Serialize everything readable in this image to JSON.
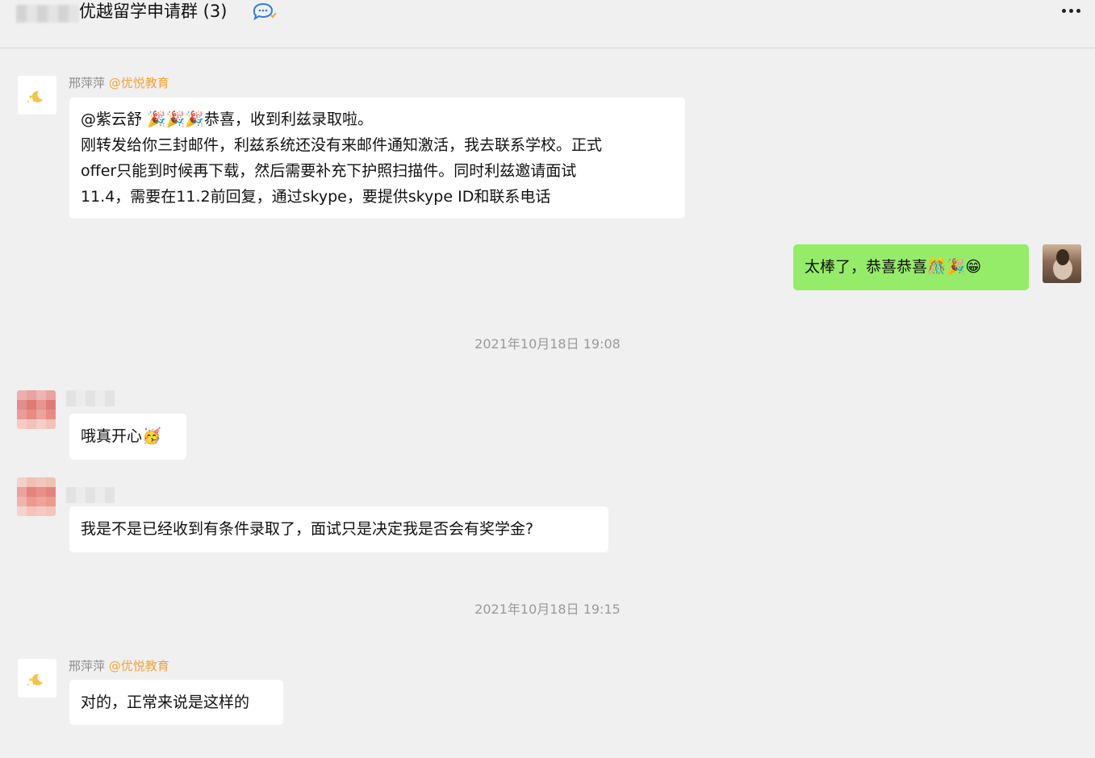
{
  "header": {
    "title": "优越留学申请群 (3)",
    "icons": [
      "chat-bubble-icon",
      "more-dots-icon"
    ]
  },
  "messages": [
    {
      "sender_name": "邢萍萍",
      "sender_org": "@优悦教育",
      "avatar": "moon-stars-icon",
      "lines": [
        "@紫云舒 🎉🎉🎉恭喜，收到利兹录取啦。",
        "刚转发给你三封邮件，利兹系统还没有来邮件通知激活，我去联系学校。正式",
        "offer只能到时候再下载，然后需要补充下护照扫描件。同时利兹邀请面试",
        "11.4，需要在11.2前回复，通过skype，要提供skype ID和联系电话"
      ]
    },
    {
      "self": true,
      "text": "太棒了，恭喜恭喜🎊🎉😁"
    },
    {
      "timestamp": "2021年10月18日 19:08"
    },
    {
      "text": "哦真开心🥳"
    },
    {
      "text": "我是不是已经收到有条件录取了，面试只是决定我是否会有奖学金?"
    },
    {
      "timestamp": "2021年10月18日 19:15"
    },
    {
      "sender_name": "邢萍萍",
      "sender_org": "@优悦教育",
      "avatar": "moon-stars-icon",
      "text": "对的，正常来说是这样的"
    }
  ]
}
